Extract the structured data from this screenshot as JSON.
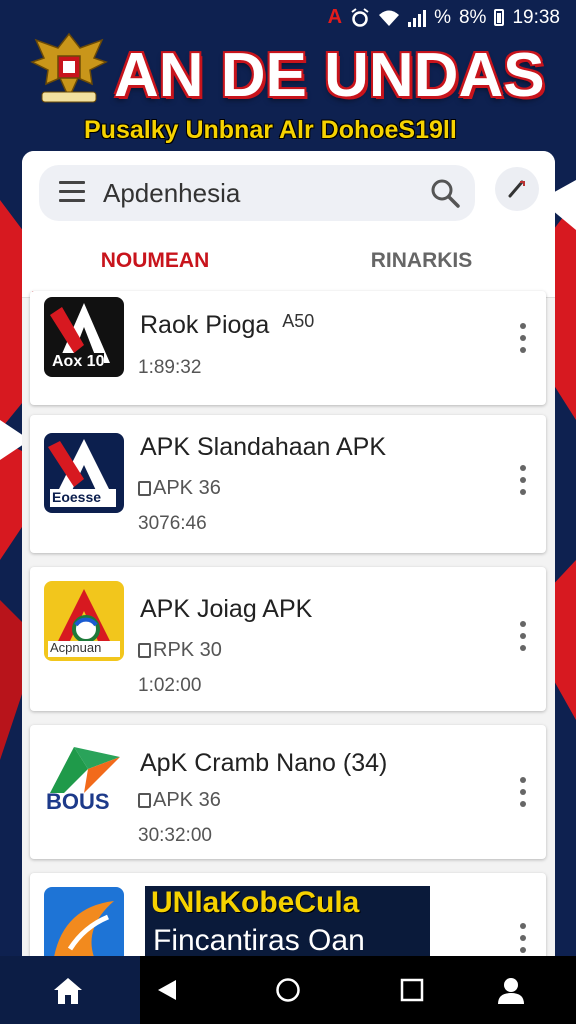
{
  "status_bar": {
    "signal_text": "%",
    "battery_text": "8%",
    "time": "19:38"
  },
  "header": {
    "title": "AN DE UNDAS",
    "subtitle": "Pusalky Unbnar Alr DohoeS19ll"
  },
  "search": {
    "value": "Apdenhesia"
  },
  "tabs": [
    {
      "label": "NOUMEAN",
      "active": true
    },
    {
      "label": "RINARKIS",
      "active": false
    }
  ],
  "apps": [
    {
      "name": "Raok Pioga",
      "badge": "A50",
      "meta": "",
      "date": "1:89:32",
      "icon_text": "Aox 10"
    },
    {
      "name": "APK Slandahaan APK",
      "meta": "APK 36",
      "date": "3076:46",
      "icon_text": "Eoesse"
    },
    {
      "name": "APK Joiag APK",
      "meta": "RPK 30",
      "date": "1:02:00",
      "icon_text": "Acpnuan"
    },
    {
      "name": "ApK Cramb Nano (34)",
      "meta": "APK 36",
      "date": "30:32:00",
      "icon_text": "BOUS"
    },
    {
      "name": "",
      "meta": "",
      "date": "",
      "icon_text": ""
    }
  ],
  "promo": {
    "line1": "UNlaKobeCula",
    "line2": "Fincantiras Oan"
  },
  "colors": {
    "accent_red": "#c8141c",
    "brand_navy": "#0e2150",
    "highlight_yellow": "#f6d200"
  },
  "icons": [
    "menu-icon",
    "search-icon",
    "pencil-icon",
    "home-icon",
    "back-icon",
    "circle-home-icon",
    "square-recents-icon",
    "person-icon",
    "more-vertical-icon",
    "wifi-icon",
    "alarm-icon"
  ]
}
